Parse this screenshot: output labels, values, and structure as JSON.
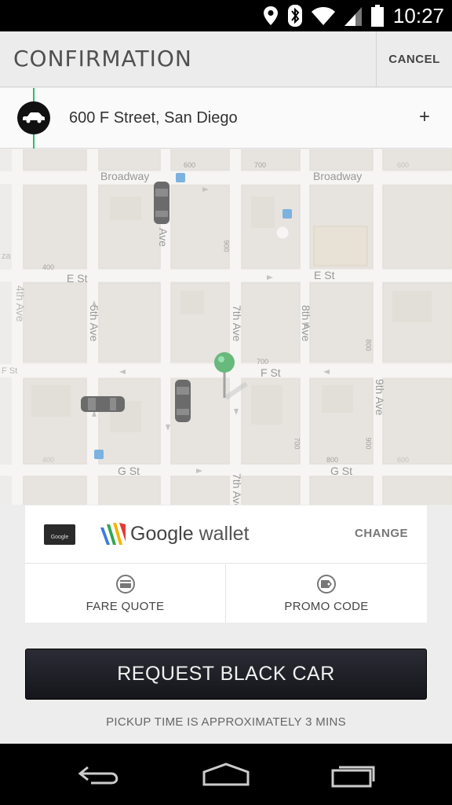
{
  "status_bar": {
    "time": "10:27"
  },
  "header": {
    "title": "CONFIRMATION",
    "cancel_label": "CANCEL"
  },
  "pickup": {
    "address": "600 F Street, San Diego",
    "add_label": "+"
  },
  "map": {
    "streets": {
      "broadway_left": "Broadway",
      "broadway_right": "Broadway",
      "e_st_left": "E St",
      "e_st_right": "E St",
      "f_st": "F St",
      "f_st_edge": "F St",
      "g_st_left": "G St",
      "g_st_right": "G St",
      "fourth_ave": "4th Ave",
      "fifth_ave": "5th Ave",
      "sixth_ave": "Ave",
      "seventh_ave": "7th Ave",
      "seventh_ave_bottom": "7th Ave",
      "eighth_ave": "8th Ave",
      "ninth_ave": "9th Ave",
      "za": "za"
    },
    "numbers": {
      "n600": "600",
      "n700a": "700",
      "n600b": "600",
      "n400": "400",
      "n900": "900",
      "n700b": "700",
      "n800a": "800",
      "n700c": "700",
      "n800b": "800",
      "n400b": "400",
      "n600c": "600",
      "n900b": "900"
    }
  },
  "payment": {
    "card_label": "Google",
    "provider_google": "Google",
    "provider_wallet": "wallet",
    "change_label": "CHANGE",
    "fare_quote_label": "FARE QUOTE",
    "promo_code_label": "PROMO CODE"
  },
  "request_button_label": "REQUEST BLACK CAR",
  "pickup_time_text": "PICKUP TIME IS APPROXIMATELY 3 MINS",
  "colors": {
    "accent_green": "#27c06b",
    "button_dark": "#1f1f27"
  }
}
